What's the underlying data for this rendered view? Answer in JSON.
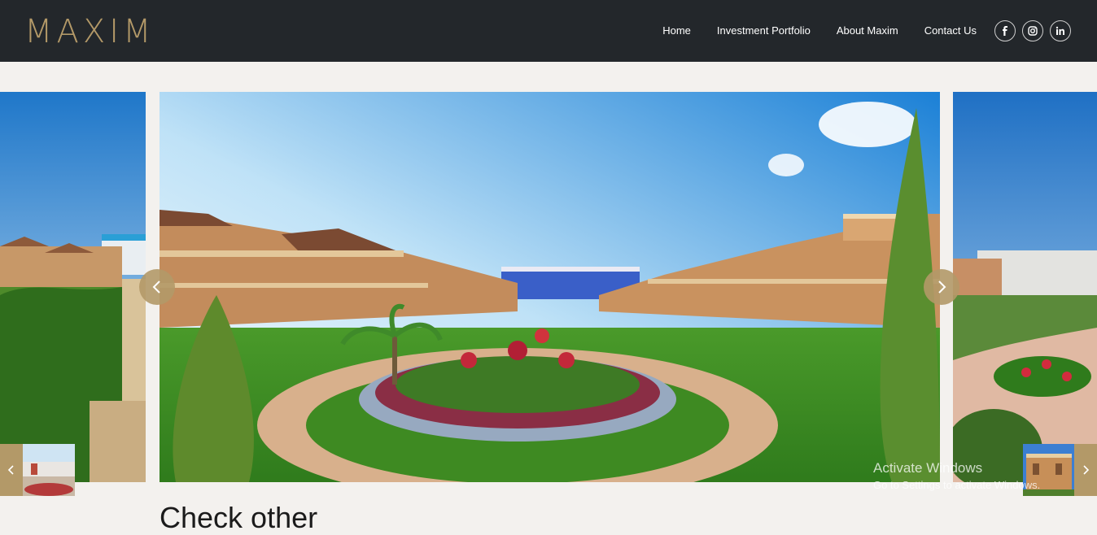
{
  "brand": {
    "logo_text": "MAXIM",
    "accent_color": "#b39968",
    "header_bg": "#23272b"
  },
  "nav": {
    "items": [
      {
        "label": "Home"
      },
      {
        "label": "Investment Portfolio"
      },
      {
        "label": "About Maxim"
      },
      {
        "label": "Contact Us"
      }
    ]
  },
  "social": [
    "facebook-icon",
    "instagram-icon",
    "linkedin-icon"
  ],
  "carousel": {
    "prev_icon": "chevron-left-icon",
    "next_icon": "chevron-right-icon"
  },
  "section": {
    "title": "Check other"
  },
  "watermark": {
    "line1": "Activate Windows",
    "line2": "Go to Settings to activate Windows."
  }
}
